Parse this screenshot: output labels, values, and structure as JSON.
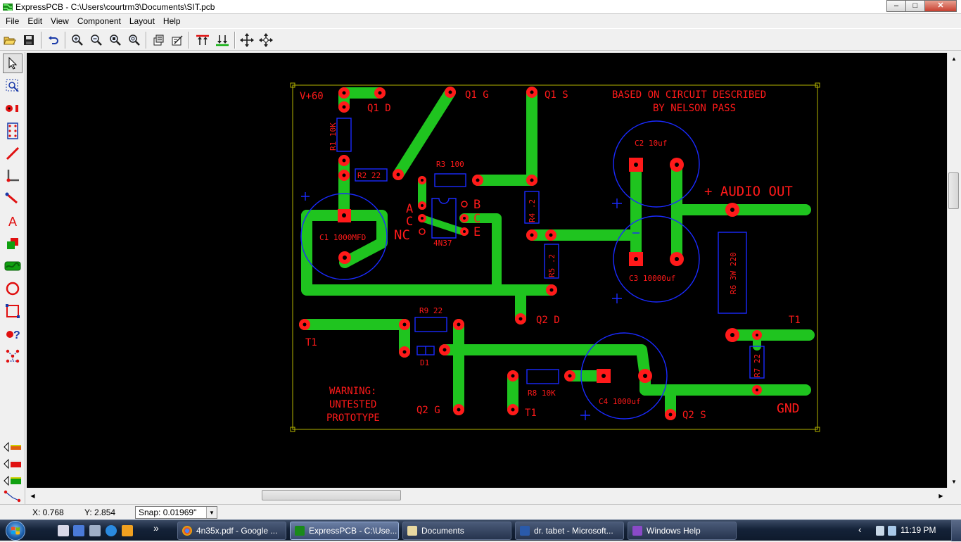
{
  "window": {
    "title": "ExpressPCB - C:\\Users\\courtrm3\\Documents\\SIT.pcb",
    "minimize": "–",
    "maximize": "□",
    "close": "✕"
  },
  "menu": [
    "File",
    "Edit",
    "View",
    "Component",
    "Layout",
    "Help"
  ],
  "toolbar_icons": [
    "open-icon",
    "save-icon",
    "undo-icon",
    "zoom-in-icon",
    "zoom-out-icon",
    "zoom-window-icon",
    "zoom-fit-icon",
    "component-properties-icon",
    "pad-properties-icon",
    "layer-up-icon",
    "layer-down-icon",
    "move-icon",
    "pan-icon"
  ],
  "left_tools": [
    "select-icon",
    "zoom-icon",
    "pad-icon",
    "component-icon",
    "trace-icon",
    "corner-icon",
    "angle-trace-icon",
    "text-icon",
    "layer-icon",
    "silk-icon",
    "circle-icon",
    "rectangle-icon",
    "query-icon",
    "netlist-icon"
  ],
  "layer_buttons": [
    "top-layer-icon",
    "bottom-layer-icon",
    "silkscreen-layer-icon",
    "ratsnest-icon"
  ],
  "pcb": {
    "silkscreen_labels": {
      "vplus": "V+60",
      "q1d": "Q1 D",
      "q1g": "Q1 G",
      "q1s": "Q1 S",
      "credit_line1": "BASED ON CIRCUIT DESCRIBED",
      "credit_line2": "BY NELSON PASS",
      "audio_out": "+ AUDIO OUT",
      "nc": "NC",
      "a": "A",
      "c_left": "C",
      "b": "B",
      "c_right": "C",
      "e": "E",
      "q2d": "Q2 D",
      "t1_left": "T1",
      "t1_right": "T1",
      "t1_bottom": "T1",
      "warning1": "WARNING:",
      "warning2": "UNTESTED",
      "warning3": "PROTOTYPE",
      "q2g": "Q2 G",
      "q2s": "Q2 S",
      "gnd": "GND"
    },
    "component_labels": {
      "r1": "R1 10K",
      "r2": "R2 22",
      "r3": "R3 100",
      "r4": "R4 .2",
      "r5": "R5 .2",
      "r6": "R6 3W 220",
      "r7": "R7 22",
      "r8": "R8 10K",
      "r9": "R9 22",
      "c1": "C1 1000MFD",
      "c2": "C2 10uf",
      "c3": "C3 10000uf",
      "c4": "C4 1000uf",
      "ic": "4N37",
      "d1": "D1",
      "plus": "+"
    },
    "colors": {
      "trace": "#1fc41f",
      "pad": "#ff1a1a",
      "silk_red": "#ff1a1a",
      "outline_blue": "#1a2aff",
      "board_edge": "#b4b400",
      "background": "#000000"
    }
  },
  "status": {
    "x": "X: 0.768",
    "y": "Y: 2.854",
    "snap": "Snap:  0.01969\""
  },
  "taskbar": {
    "overflow": "»",
    "items": [
      {
        "label": "4n35x.pdf - Google ...",
        "active": false
      },
      {
        "label": "ExpressPCB - C:\\Use...",
        "active": true
      },
      {
        "label": "Documents",
        "active": false
      },
      {
        "label": "dr. tabet - Microsoft...",
        "active": false
      },
      {
        "label": "Windows Help",
        "active": false
      }
    ],
    "tray_arrow": "‹",
    "clock": "11:19 PM"
  }
}
